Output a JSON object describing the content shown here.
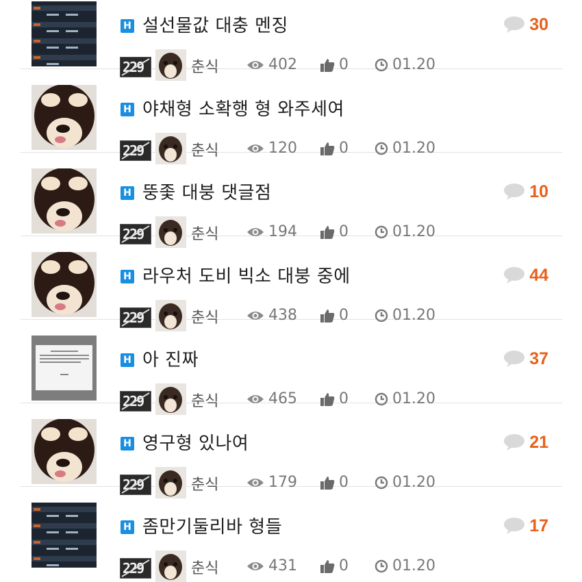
{
  "posts": [
    {
      "title": "설선물값 대충 멘징",
      "author": "춘식",
      "views": "402",
      "likes": "0",
      "date": "01.20",
      "comments": "30",
      "thumb": "table-screenshot-icon",
      "level_badge": "229"
    },
    {
      "title": "야채형 소확행 형 와주세여",
      "author": "춘식",
      "views": "120",
      "likes": "0",
      "date": "01.20",
      "comments": "",
      "thumb": "chihuahua-photo",
      "level_badge": "229"
    },
    {
      "title": "뚱좇 대붕 댓글점",
      "author": "춘식",
      "views": "194",
      "likes": "0",
      "date": "01.20",
      "comments": "10",
      "thumb": "chihuahua-photo",
      "level_badge": "229"
    },
    {
      "title": "라우처 도비 빅소 대붕 중에",
      "author": "춘식",
      "views": "438",
      "likes": "0",
      "date": "01.20",
      "comments": "44",
      "thumb": "chihuahua-photo",
      "level_badge": "229"
    },
    {
      "title": "아 진짜",
      "author": "춘식",
      "views": "465",
      "likes": "0",
      "date": "01.20",
      "comments": "37",
      "thumb": "dialog-screenshot-icon",
      "level_badge": "229"
    },
    {
      "title": "영구형 있나여",
      "author": "춘식",
      "views": "179",
      "likes": "0",
      "date": "01.20",
      "comments": "21",
      "thumb": "chihuahua-photo",
      "level_badge": "229"
    },
    {
      "title": "좀만기둘리바 형들",
      "author": "춘식",
      "views": "431",
      "likes": "0",
      "date": "01.20",
      "comments": "17",
      "thumb": "table-screenshot-icon",
      "level_badge": "229"
    }
  ],
  "badge_letter": "H",
  "colors": {
    "accent": "#e8601a",
    "badge": "#1a8fe0",
    "divider": "#e2e2e2"
  }
}
